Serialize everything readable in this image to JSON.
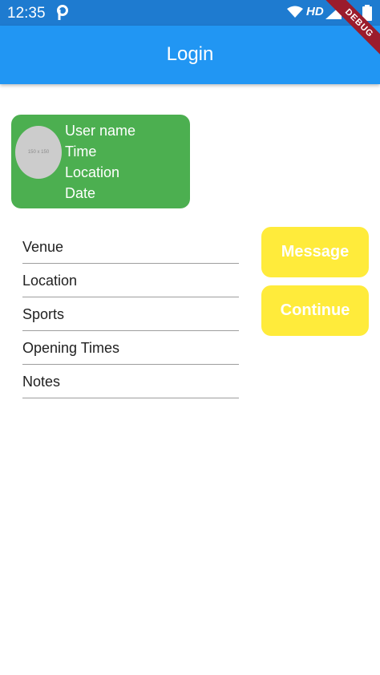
{
  "status_bar": {
    "time": "12:35",
    "network_label": "HD"
  },
  "app_bar": {
    "title": "Login"
  },
  "debug_banner": "DEBUG",
  "profile_card": {
    "avatar_placeholder": "150 x 150",
    "lines": [
      "User name",
      "Time",
      "Location",
      "Date"
    ]
  },
  "list": {
    "items": [
      "Venue",
      "Location",
      "Sports",
      "Opening Times",
      "Notes"
    ]
  },
  "buttons": {
    "message": "Message",
    "continue": "Continue"
  },
  "colors": {
    "status_bar": "#1e7bd0",
    "app_bar": "#2196f3",
    "card": "#4caf50",
    "button": "#ffeb3b"
  }
}
